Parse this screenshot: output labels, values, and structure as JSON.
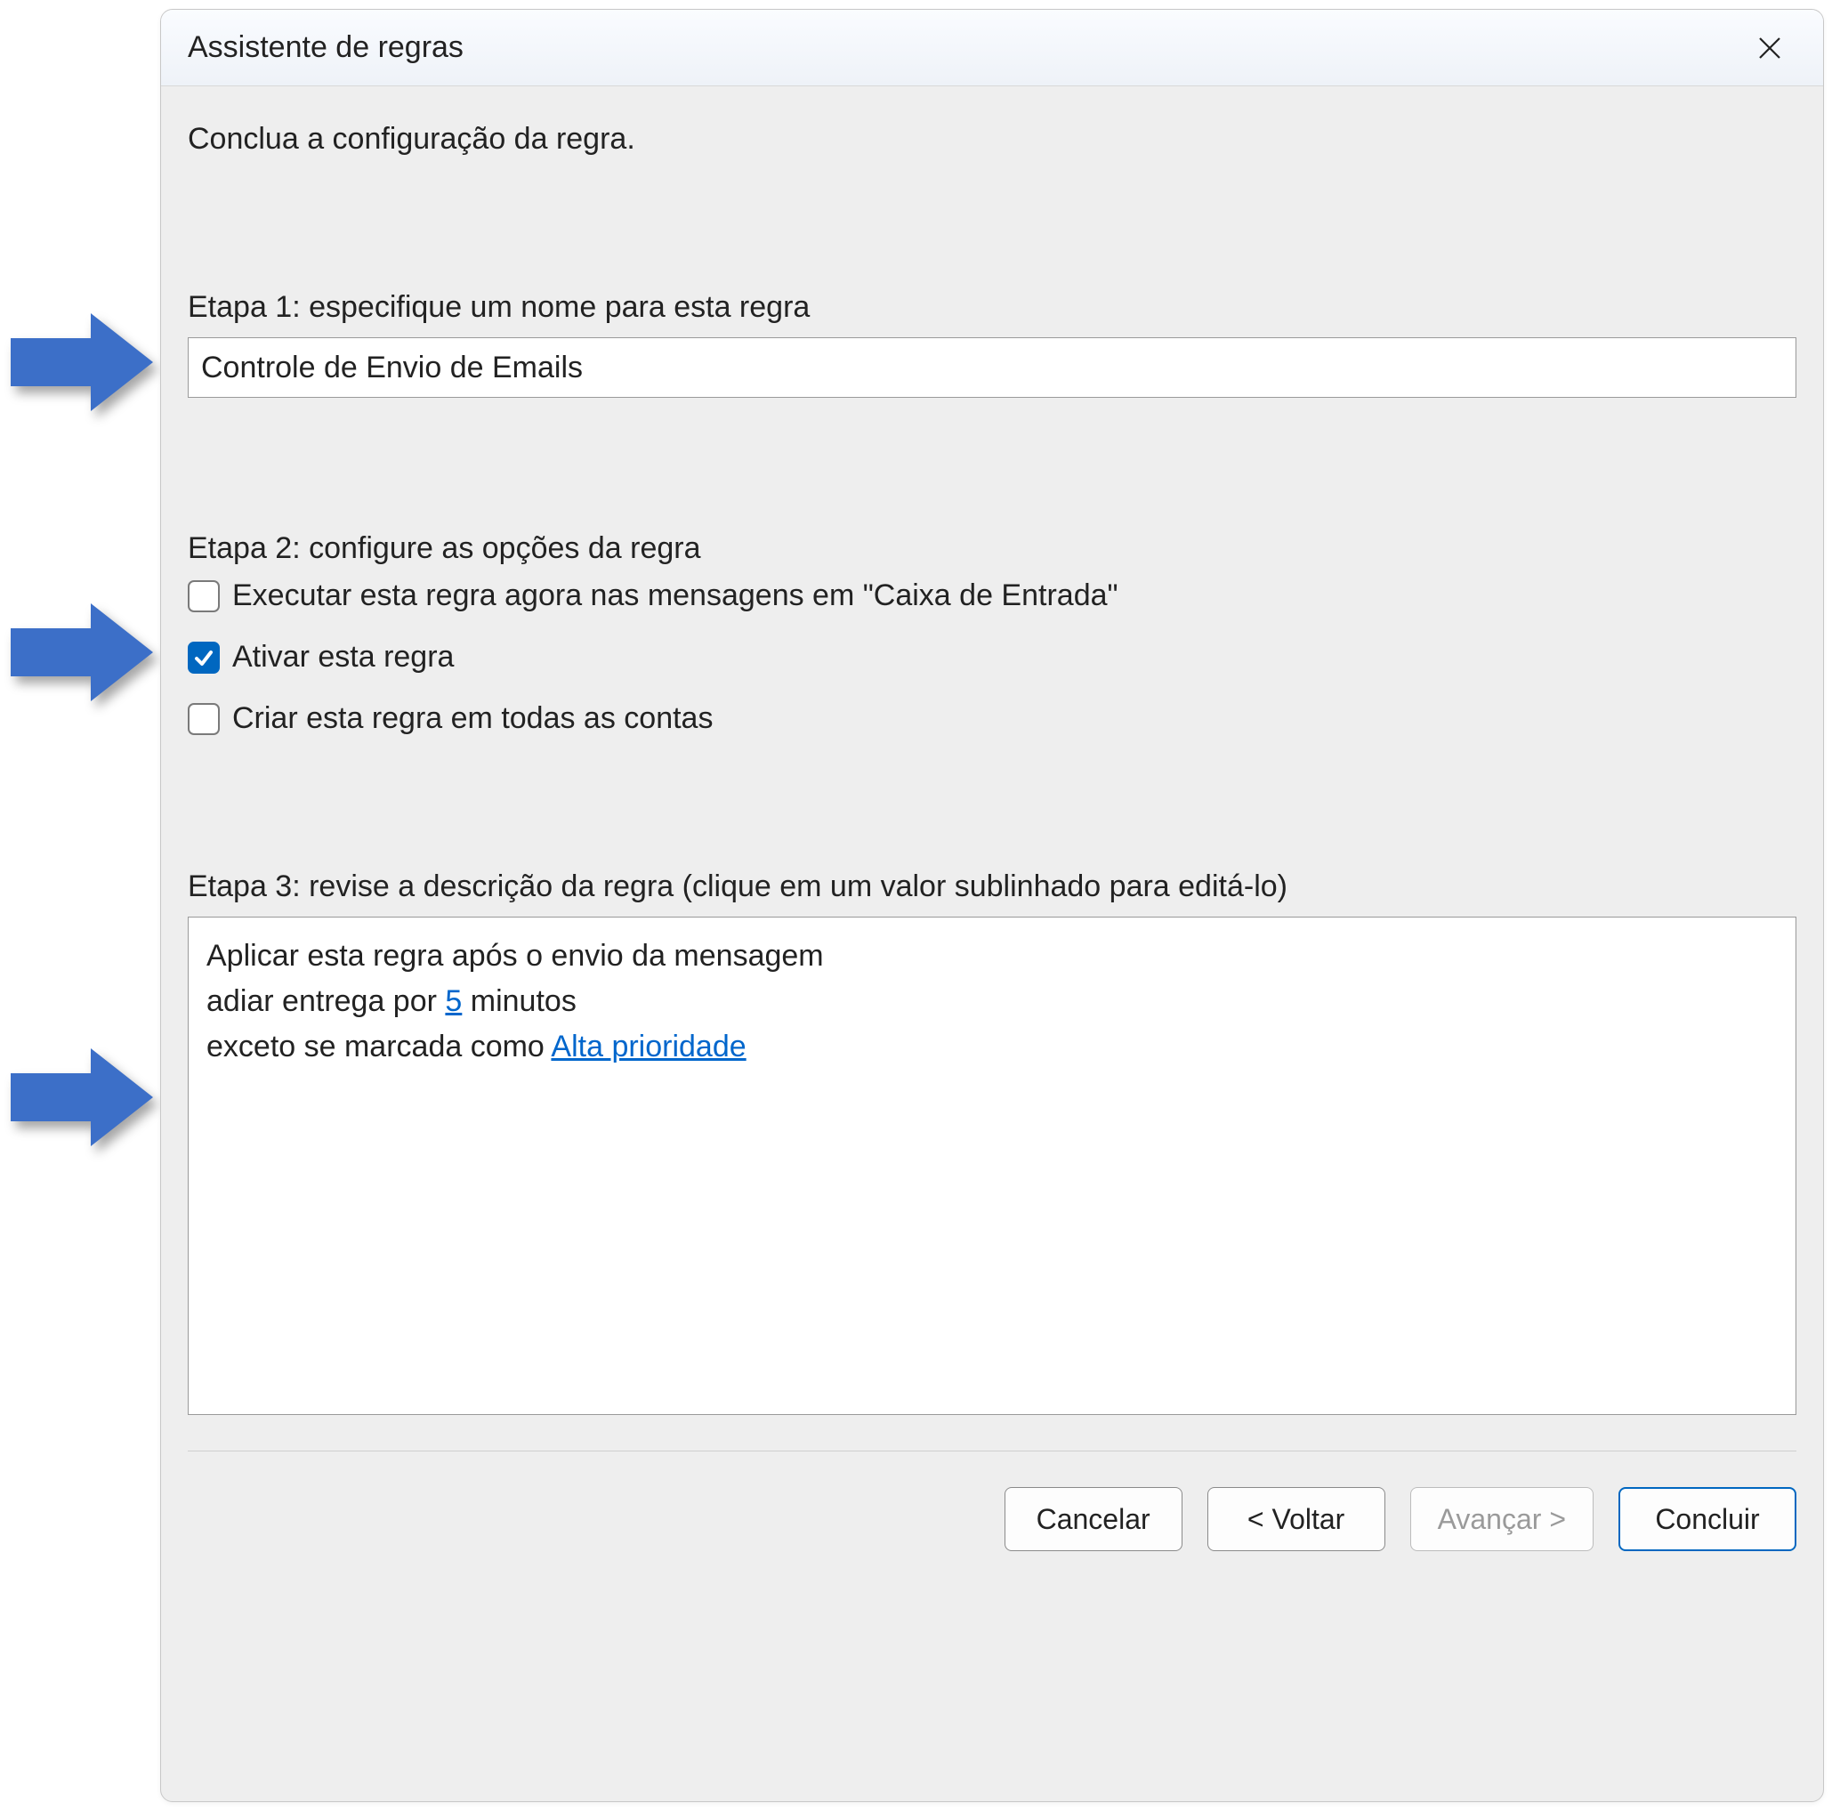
{
  "dialog": {
    "title": "Assistente de regras",
    "instruction": "Conclua a configuração da regra."
  },
  "step1": {
    "label": "Etapa 1: especifique um nome para esta regra",
    "value": "Controle de Envio de Emails"
  },
  "step2": {
    "label": "Etapa 2: configure as opções da regra",
    "opt_run_now": "Executar esta regra agora nas mensagens em \"Caixa de Entrada\"",
    "opt_enable": "Ativar esta regra",
    "opt_all_accounts": "Criar esta regra em todas as contas",
    "checked": {
      "run_now": false,
      "enable": true,
      "all_accounts": false
    }
  },
  "step3": {
    "label": "Etapa 3: revise a descrição da regra (clique em um valor sublinhado para editá-lo)",
    "line1": "Aplicar esta regra após o envio da mensagem",
    "line2_prefix": "adiar entrega por ",
    "line2_link": "5",
    "line2_suffix": " minutos",
    "line3_prefix": "exceto se marcada como ",
    "line3_link": "Alta prioridade"
  },
  "buttons": {
    "cancel": "Cancelar",
    "back": "< Voltar",
    "next": "Avançar >",
    "finish": "Concluir"
  }
}
